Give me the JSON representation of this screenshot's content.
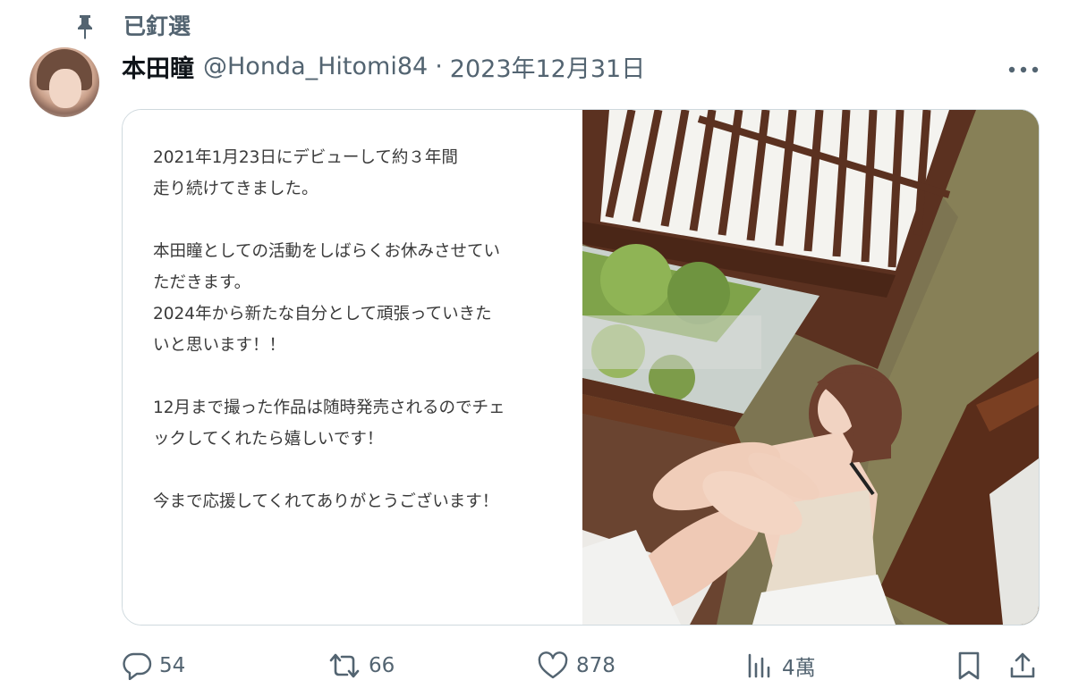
{
  "pinned": {
    "label": "已釘選",
    "icon": "pin-icon"
  },
  "author": {
    "display_name": "本田瞳",
    "handle": "@Honda_Hitomi84",
    "separator": "·",
    "date": "2023年12月31日"
  },
  "menu": {
    "icon": "more-icon"
  },
  "post": {
    "message_lines": [
      "2021年1月23日にデビューして約３年間",
      "走り続けてきました。",
      "",
      "本田瞳としての活動をしばらくお休みさせてい",
      "ただきます。",
      "2024年から新たな自分として頑張っていきた",
      "いと思います！！",
      "",
      "12月まで撮った作品は随時発売されるのでチェ",
      "ックしてくれたら嬉しいです！",
      "",
      "今まで応援してくれてありがとうございます！"
    ]
  },
  "actions": {
    "reply": {
      "icon": "reply-icon",
      "count": "54"
    },
    "repost": {
      "icon": "repost-icon",
      "count": "66"
    },
    "like": {
      "icon": "heart-icon",
      "count": "878"
    },
    "views": {
      "icon": "views-icon",
      "count": "4萬"
    },
    "bookmark": {
      "icon": "bookmark-icon"
    },
    "share": {
      "icon": "share-icon"
    }
  },
  "colors": {
    "text_primary": "#0f1419",
    "text_secondary": "#536471",
    "border": "#cfd9de"
  }
}
